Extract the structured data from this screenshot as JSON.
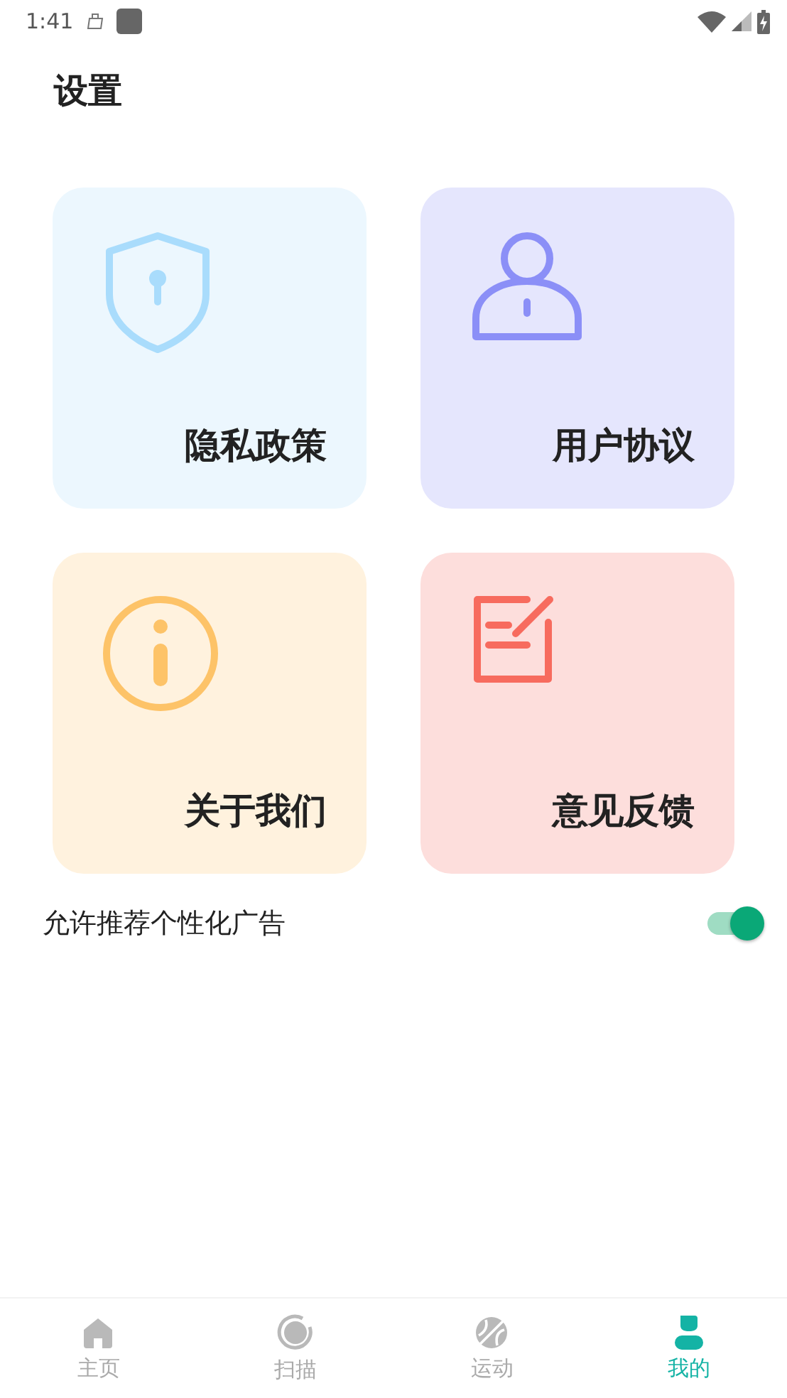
{
  "status_bar": {
    "time": "1:41"
  },
  "title": "设置",
  "cards": [
    {
      "label": "隐私政策",
      "kind": "shield",
      "color": "#a9dcfc"
    },
    {
      "label": "用户协议",
      "kind": "person",
      "color": "#8b8ff7"
    },
    {
      "label": "关于我们",
      "kind": "info",
      "color": "#fdc368"
    },
    {
      "label": "意见反馈",
      "kind": "edit",
      "color": "#f76b5e"
    }
  ],
  "toggle": {
    "label": "允许推荐个性化广告",
    "on": true
  },
  "tabs": [
    {
      "label": "主页",
      "kind": "home",
      "selected": false
    },
    {
      "label": "扫描",
      "kind": "scan",
      "selected": false
    },
    {
      "label": "运动",
      "kind": "ball",
      "selected": false
    },
    {
      "label": "我的",
      "kind": "user",
      "selected": true
    }
  ]
}
